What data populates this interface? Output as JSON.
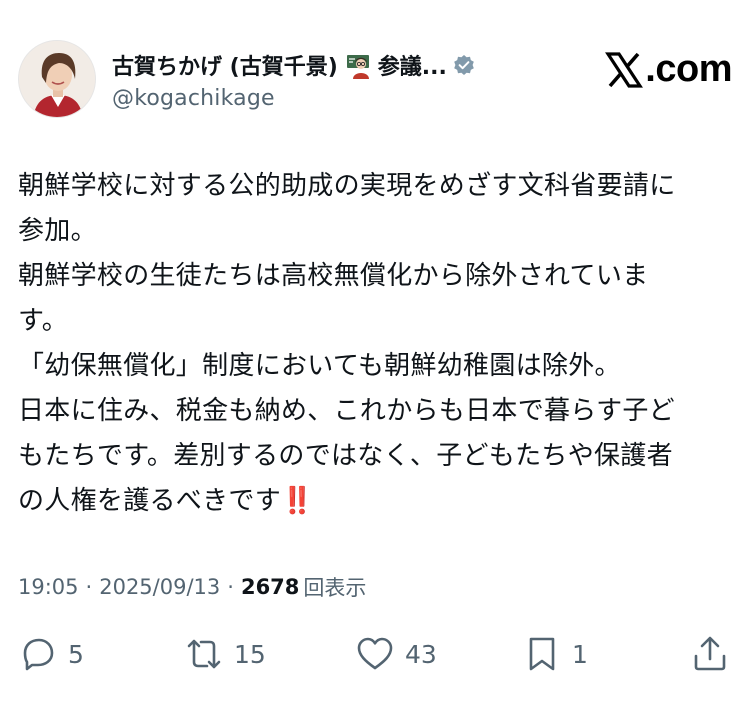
{
  "author": {
    "display_name": "古賀ちかげ (古賀千景)",
    "name_suffix": "参議...",
    "handle": "@kogachikage",
    "verified_badge_color": "#829aab"
  },
  "branding": {
    "logo_text": ".com"
  },
  "post": {
    "lines": [
      "朝鮮学校に対する公的助成の実現をめざす文科省要請に",
      "参加。",
      "朝鮮学校の生徒たちは高校無償化から除外されていま",
      "す。",
      "「幼保無償化」制度においても朝鮮幼稚園は除外。",
      "日本に住み、税金も納め、これからも日本で暮らす子ど",
      "もたちです。差別するのではなく、子どもたちや保護者",
      "の人権を護るべきです"
    ],
    "emphasis": "‼️"
  },
  "meta": {
    "time": "19:05",
    "separator": "·",
    "date": "2025/09/13",
    "views_count": "2678",
    "views_label": "回表示"
  },
  "actions": {
    "reply_count": "5",
    "repost_count": "15",
    "like_count": "43",
    "bookmark_count": "1"
  },
  "colors": {
    "text": "#0f1419",
    "secondary": "#536471",
    "emphasis_red": "#e0243a"
  }
}
